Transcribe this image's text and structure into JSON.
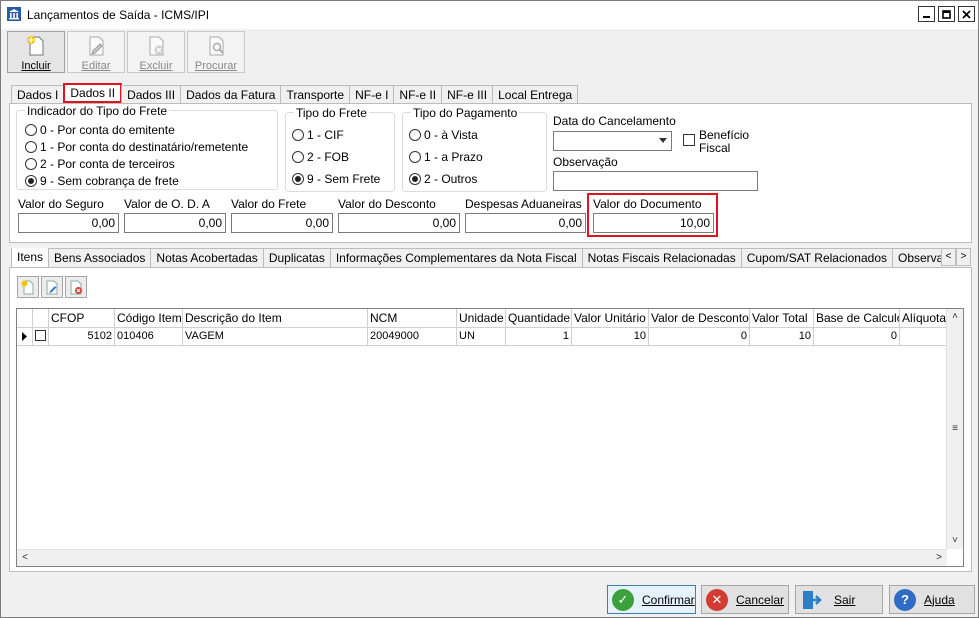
{
  "window": {
    "title": "Lançamentos de Saída - ICMS/IPI",
    "controls": {
      "minimize": "▁",
      "maximize": "□",
      "close": "✕"
    }
  },
  "toolbar": {
    "incluir": "Incluir",
    "editar": "Editar",
    "excluir": "Excluir",
    "procurar": "Procurar"
  },
  "tabs": [
    "Dados I",
    "Dados II",
    "Dados III",
    "Dados da Fatura",
    "Transporte",
    "NF-e I",
    "NF-e II",
    "NF-e III",
    "Local Entrega"
  ],
  "selected_tab": "Dados II",
  "indicador_frete": {
    "label": "Indicador do Tipo do Frete",
    "options": [
      "0 - Por conta do emitente",
      "1 - Por conta do destinatário/remetente",
      "2 - Por conta de terceiros",
      "9 - Sem cobrança de frete"
    ],
    "selected": "9 - Sem cobrança de frete"
  },
  "tipo_frete": {
    "label": "Tipo do Frete",
    "options": [
      "1 - CIF",
      "2 - FOB",
      "9 - Sem Frete"
    ],
    "selected": "9 - Sem Frete"
  },
  "tipo_pagamento": {
    "label": "Tipo do Pagamento",
    "options": [
      "0 - à Vista",
      "1 - a Prazo",
      "2 - Outros"
    ],
    "selected": "2 - Outros"
  },
  "data_cancelamento": {
    "label": "Data do Cancelamento",
    "value": ""
  },
  "beneficio_fiscal": {
    "label_line1": "Benefício",
    "label_line2": "Fiscal",
    "checked": false
  },
  "observacao": {
    "label": "Observação",
    "value": ""
  },
  "valores": {
    "seguro": {
      "label": "Valor do Seguro",
      "value": "0,00"
    },
    "oda": {
      "label": "Valor de O. D. A",
      "value": "0,00"
    },
    "frete": {
      "label": "Valor do Frete",
      "value": "0,00"
    },
    "desconto": {
      "label": "Valor do Desconto",
      "value": "0,00"
    },
    "despesas": {
      "label": "Despesas Aduaneiras",
      "value": "0,00"
    },
    "documento": {
      "label": "Valor do Documento",
      "value": "10,00"
    }
  },
  "tabs2": [
    "Itens",
    "Bens Associados",
    "Notas Acobertadas",
    "Duplicatas",
    "Informações Complementares da Nota Fiscal",
    "Notas Fiscais Relacionadas",
    "Cupom/SAT Relacionados",
    "Observação do"
  ],
  "selected_tab2": "Itens",
  "grid": {
    "columns": [
      "CFOP",
      "Código Item",
      "Descrição do Item",
      "NCM",
      "Unidade",
      "Quantidade",
      "Valor Unitário",
      "Valor de Desconto",
      "Valor Total",
      "Base de Calculo",
      "Alíquota"
    ],
    "rows": [
      [
        "5102",
        "010406",
        "VAGEM",
        "20049000",
        "UN",
        "1",
        "10",
        "0",
        "10",
        "0",
        ""
      ]
    ]
  },
  "buttons": {
    "confirmar": "Confirmar",
    "cancelar": "Cancelar",
    "sair": "Sair",
    "ajuda": "Ajuda"
  },
  "colors": {
    "highlight_red": "#e0141e",
    "confirm_green": "#3ca13c",
    "cancel_red": "#d23c32",
    "exit_blue": "#2f7cc8",
    "help_blue": "#2f6bc8"
  }
}
